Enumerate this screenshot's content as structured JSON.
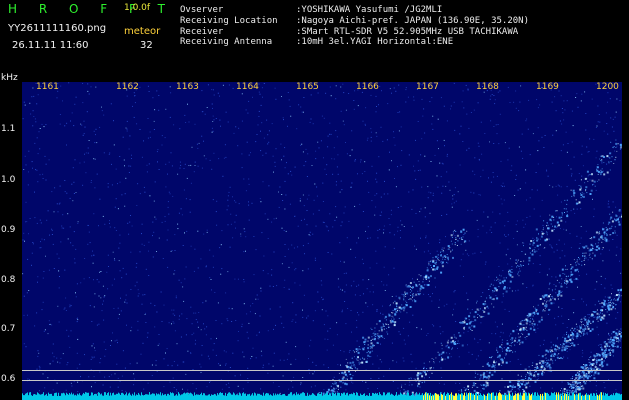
{
  "header": {
    "app_name": "H R O F F T",
    "version": "1.0.0f",
    "filename": "YY2611111160.png",
    "datetime": "26.11.11 11:60",
    "meteor_label": "meteor",
    "meteor_count": "32"
  },
  "info": [
    {
      "key": "Ovserver",
      "value": ":YOSHIKAWA Yasufumi /JG2MLI"
    },
    {
      "key": "Receiving Location",
      "value": ":Nagoya Aichi-pref. JAPAN (136.90E, 35.20N)"
    },
    {
      "key": "Receiver",
      "value": ":SMart RTL-SDR V5 52.905MHz USB TACHIKAWA"
    },
    {
      "key": "Receiving Antenna",
      "value": ":10mH 3el.YAGI Horizontal:ENE"
    }
  ],
  "axis": {
    "y_unit": "kHz",
    "y_ticks": [
      "1.1",
      "1.0",
      "0.9",
      "0.8",
      "0.7",
      "0.6"
    ],
    "time_ticks": [
      "1161",
      "1162",
      "1163",
      "1164",
      "1165",
      "1166",
      "1167",
      "1168",
      "1169",
      "1200"
    ]
  },
  "colors": {
    "background": "#000000",
    "panel": "#00066a",
    "signal": "#4fa8ff",
    "noise_floor": "#00c8e8",
    "meteor_burst": "#ffff3c",
    "title_green": "#2ef02e",
    "label_yellow": "#ffd23a"
  }
}
